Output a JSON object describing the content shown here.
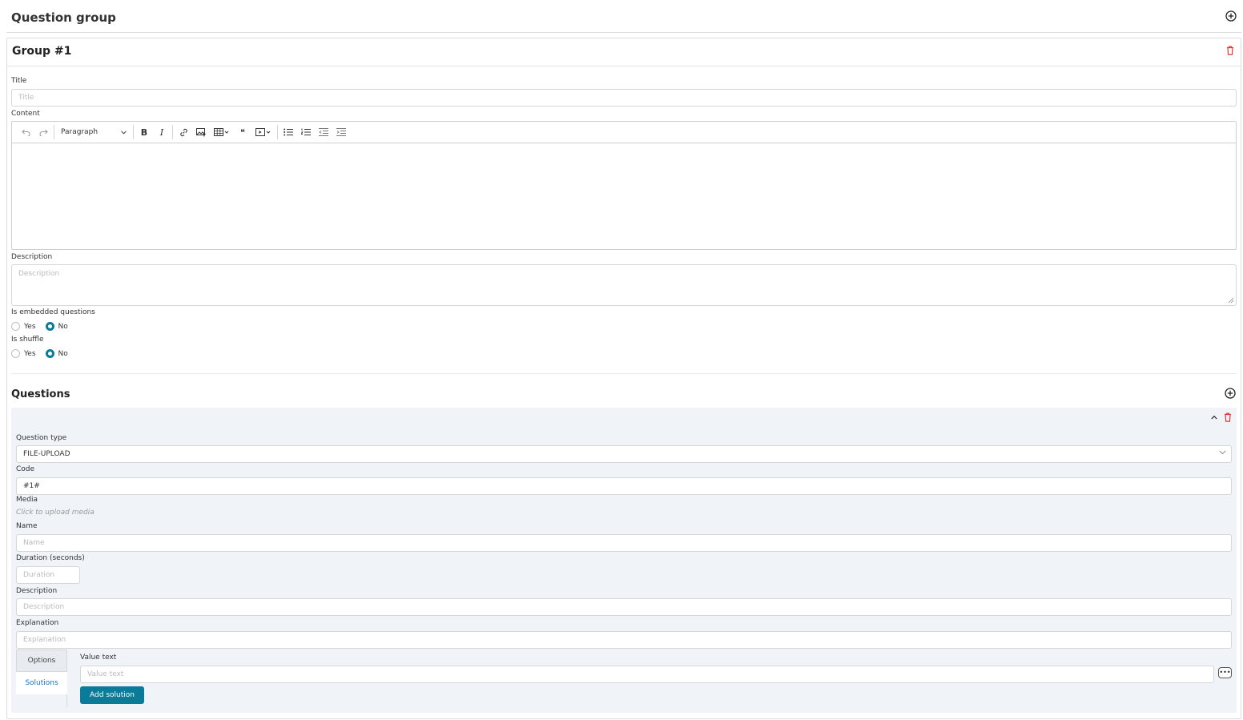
{
  "page": {
    "title": "Question group"
  },
  "group": {
    "title": "Group #1",
    "fields": {
      "title_label": "Title",
      "title_placeholder": "Title",
      "content_label": "Content",
      "description_label": "Description",
      "description_placeholder": "Description",
      "embedded_label": "Is embedded questions",
      "shuffle_label": "Is shuffle",
      "yes": "Yes",
      "no": "No",
      "embedded_value": "No",
      "shuffle_value": "No"
    },
    "editor": {
      "paragraph_label": "Paragraph",
      "bold_label": "B",
      "italic_label": "I",
      "quote_label": "❝"
    }
  },
  "questions": {
    "title": "Questions",
    "item": {
      "question_type_label": "Question type",
      "question_type_value": "FILE-UPLOAD",
      "code_label": "Code",
      "code_value": "#1#",
      "media_label": "Media",
      "media_hint": "Click to upload media",
      "name_label": "Name",
      "name_placeholder": "Name",
      "duration_label": "Duration (seconds)",
      "duration_placeholder": "Duration",
      "description_label": "Description",
      "description_placeholder": "Description",
      "explanation_label": "Explanation",
      "explanation_placeholder": "Explanation",
      "tabs": [
        {
          "label": "Options",
          "active": false
        },
        {
          "label": "Solutions",
          "active": true
        }
      ],
      "value_text_label": "Value text",
      "value_text_placeholder": "Value text",
      "more_label": "•••",
      "add_solution_label": "Add solution"
    }
  },
  "colors": {
    "accent": "#0a7c99",
    "danger": "#e53935",
    "link": "#1a73c7"
  },
  "icons": [
    "plus-circle-icon",
    "trash-icon",
    "chevron-up-icon",
    "chevron-down-icon",
    "undo-icon",
    "redo-icon",
    "link-icon",
    "image-icon",
    "table-icon",
    "media-icon",
    "bullet-list-icon",
    "numbered-list-icon",
    "outdent-icon",
    "indent-icon"
  ]
}
